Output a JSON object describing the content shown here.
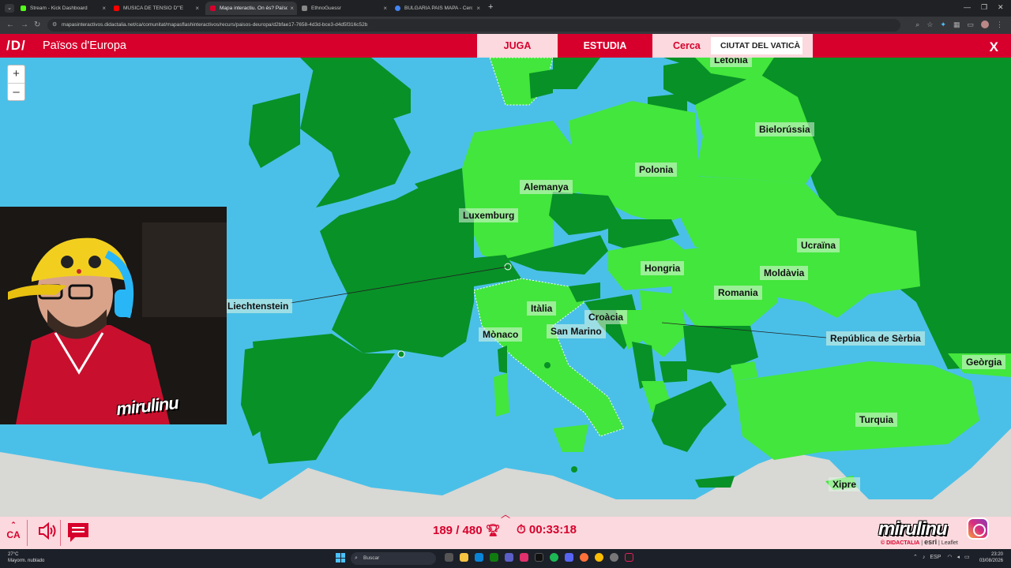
{
  "browser": {
    "tabs": [
      {
        "title": "Stream - Kick Dashboard",
        "color": "#53fc18"
      },
      {
        "title": "MÚSICA DE TENSIÓ D'\"EL C",
        "color": "#ff0000"
      },
      {
        "title": "Mapa interactiu. On és? Països",
        "color": "#d7002c"
      },
      {
        "title": "EthnoGuessr",
        "color": "#888888"
      },
      {
        "title": "BULGARIA PAIS MAPA - Cerca",
        "color": "#4285f4"
      }
    ],
    "url": "mapasinteractivos.didactalia.net/ca/comunitat/mapasflashinteractivos/recurs/paisos-deuropa/d2bfae17-7658-4d3d-bce3-d4d5f316c52b"
  },
  "app": {
    "logo": "/D/",
    "title": "Països d'Europa",
    "tab_play": "JUGA",
    "tab_study": "ESTUDIA",
    "search_label": "Cerca",
    "search_value": "CIUTAT DEL VATICÀ",
    "close": "X"
  },
  "map": {
    "zoom_in": "+",
    "zoom_out": "–",
    "labels": {
      "letonia": "Letònia",
      "bielorussia": "Bielorússia",
      "polonia": "Polonia",
      "alemanya": "Alemanya",
      "luxemburg": "Luxemburg",
      "ucraina": "Ucraïna",
      "hongria": "Hongria",
      "moldavia": "Moldàvia",
      "romania": "Romania",
      "liechtenstein": "Liechtenstein",
      "italia": "Itàlia",
      "croacia": "Croàcia",
      "monaco": "Mònaco",
      "san_marino": "San Marino",
      "serbia": "República de Sèrbia",
      "georgia": "Geòrgia",
      "turquia": "Turquia",
      "xipre": "Xipre"
    }
  },
  "stream": {
    "watermark": "mirulinu",
    "brand": "mirulinu"
  },
  "bottom": {
    "lang": "CA",
    "score": "189 / 480",
    "timer": "00:33:18",
    "credit_didactalia": "© DIDACTALIA",
    "credit_esri": "esri",
    "credit_leaflet": "Leaflet"
  },
  "taskbar": {
    "temp": "27°C",
    "weather": "Mayorm. nublado",
    "search": "Buscar",
    "lang": "ESP",
    "time": "23:20",
    "date": "03/08/2026"
  },
  "colors": {
    "brand_red": "#d7002c",
    "sea": "#4ac0e8",
    "land_light": "#43e63c",
    "land_dark": "#089127",
    "land_neutral": "#d8d8d4"
  }
}
